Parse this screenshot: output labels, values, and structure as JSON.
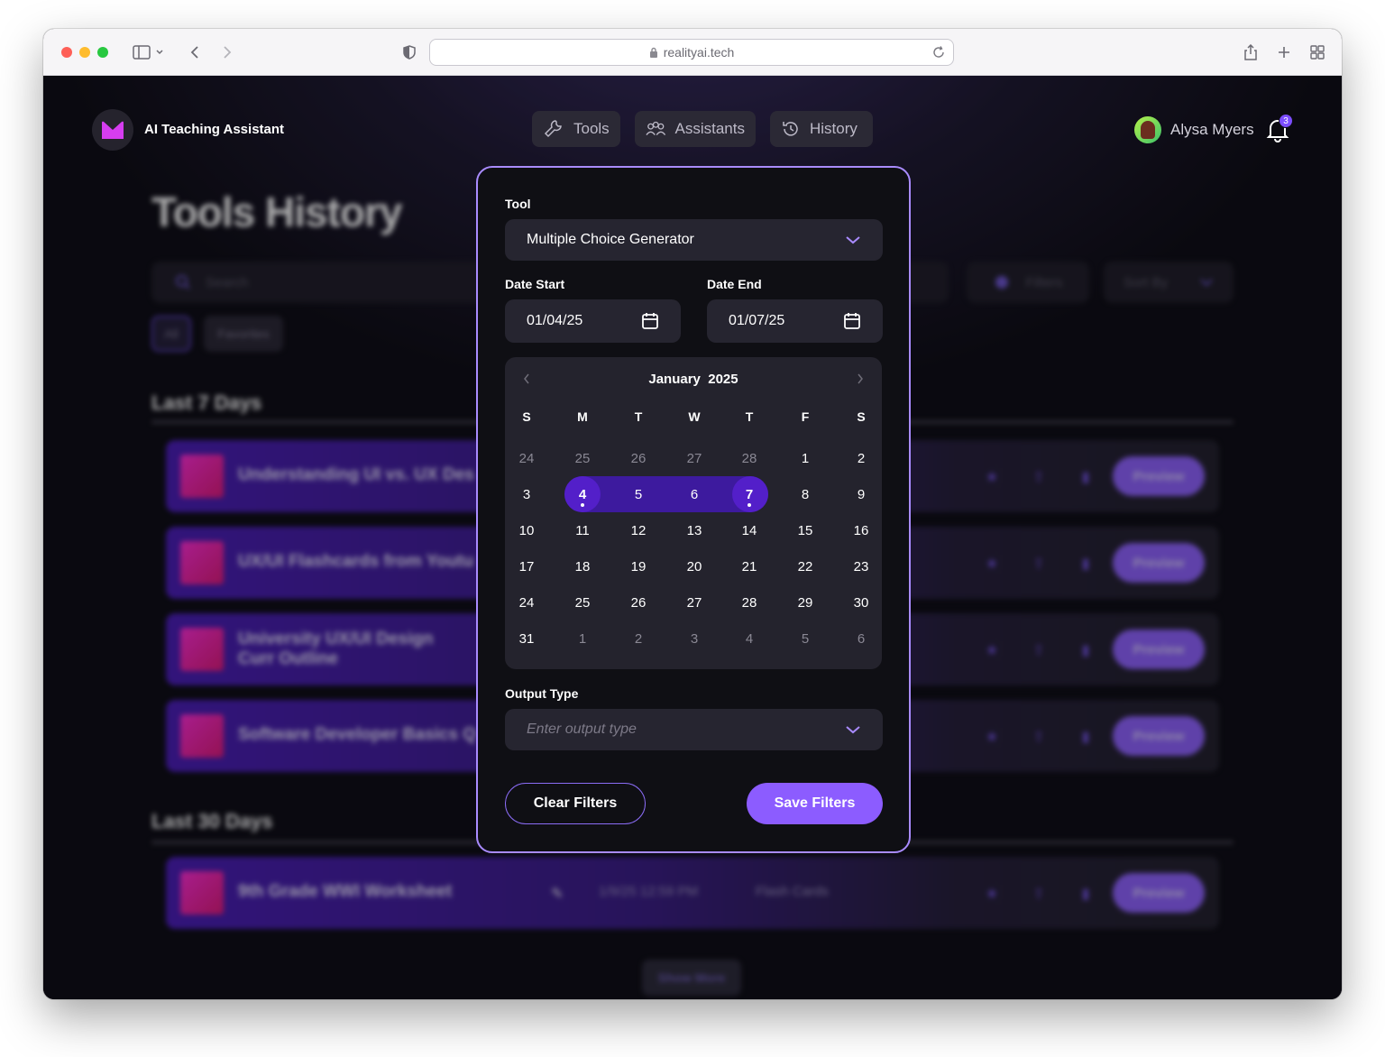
{
  "browser": {
    "url": "realityai.tech"
  },
  "header": {
    "brand": "AI Teaching Assistant",
    "nav": [
      {
        "label": "Tools",
        "icon": "wrench-icon"
      },
      {
        "label": "Assistants",
        "icon": "users-icon"
      },
      {
        "label": "History",
        "icon": "history-icon"
      }
    ],
    "user_name": "Alysa Myers",
    "notification_count": "3"
  },
  "page": {
    "title": "Tools History",
    "search_placeholder": "Search",
    "filters_label": "Filters",
    "sort_label": "Sort By",
    "chips": [
      "All",
      "Favorites"
    ],
    "sections": [
      {
        "title": "Last 7 Days",
        "rows": [
          {
            "title": "Understanding UI vs. UX Des"
          },
          {
            "title": "UX/UI Flashcards from Youtu"
          },
          {
            "title": "University UX/UI Design Curr Outline"
          },
          {
            "title": "Software Developer Basics Q"
          }
        ]
      },
      {
        "title": "Last 30 Days",
        "rows": [
          {
            "title": "9th Grade WWI Worksheet",
            "date": "1/9/25 12:59 PM",
            "type": "Flash Cards"
          }
        ]
      }
    ],
    "preview_label": "Preview",
    "show_more": "Show More"
  },
  "modal": {
    "tool_label": "Tool",
    "tool_value": "Multiple Choice Generator",
    "date_start_label": "Date Start",
    "date_start_value": "01/04/25",
    "date_end_label": "Date End",
    "date_end_value": "01/07/25",
    "calendar": {
      "month": "January",
      "year": "2025",
      "weekdays": [
        "S",
        "M",
        "T",
        "W",
        "T",
        "F",
        "S"
      ],
      "weeks": [
        [
          "24",
          "25",
          "26",
          "27",
          "28",
          "1",
          "2"
        ],
        [
          "3",
          "4",
          "5",
          "6",
          "7",
          "8",
          "9"
        ],
        [
          "10",
          "11",
          "12",
          "13",
          "14",
          "15",
          "16"
        ],
        [
          "17",
          "18",
          "19",
          "20",
          "21",
          "22",
          "23"
        ],
        [
          "24",
          "25",
          "26",
          "27",
          "28",
          "29",
          "30"
        ],
        [
          "31",
          "1",
          "2",
          "3",
          "4",
          "5",
          "6"
        ]
      ],
      "range_start": "4",
      "range_end": "7"
    },
    "output_type_label": "Output Type",
    "output_type_placeholder": "Enter output type",
    "clear_label": "Clear Filters",
    "save_label": "Save Filters"
  },
  "colors": {
    "accent": "#8c5cff",
    "modal_border": "#a98bff",
    "range": "#3d1a9e"
  }
}
